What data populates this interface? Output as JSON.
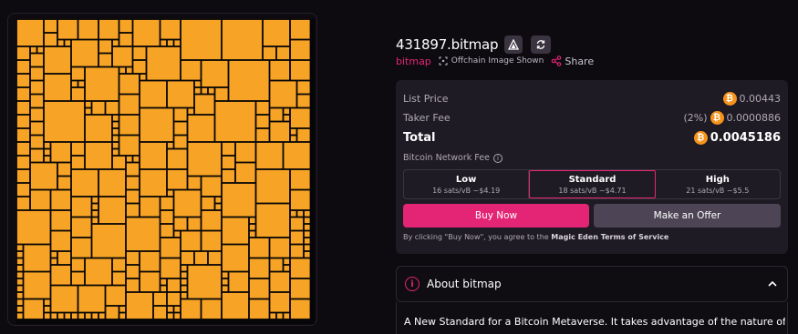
{
  "nft": {
    "title": "431897.bitmap",
    "collection": "bitmap",
    "offchain_label": "Offchain Image Shown",
    "share_label": "Share",
    "image_color": "#f7a325"
  },
  "price": {
    "list_price_label": "List Price",
    "list_price_value": "0.00443",
    "taker_fee_label": "Taker Fee",
    "taker_fee_pct": "(2%)",
    "taker_fee_value": "0.0000886",
    "total_label": "Total",
    "total_value": "0.0045186",
    "btc_symbol": "₿"
  },
  "network_fee": {
    "label": "Bitcoin Network Fee",
    "options": [
      {
        "name": "Low",
        "detail": "16 sats/vB ~$4.19"
      },
      {
        "name": "Standard",
        "detail": "18 sats/vB ~$4.71"
      },
      {
        "name": "High",
        "detail": "21 sats/vB ~$5.5"
      }
    ],
    "selected": "Standard"
  },
  "actions": {
    "buy_now": "Buy Now",
    "make_offer": "Make an Offer"
  },
  "terms": {
    "prefix": "By clicking \"Buy Now\", you agree to the ",
    "link": "Magic Eden Terms of Service"
  },
  "about": {
    "title": "About bitmap",
    "text": "A New Standard for a Bitcoin Metaverse. It takes advantage of the nature of data's"
  },
  "colors": {
    "accent": "#e42575",
    "btc": "#f7931a",
    "panel": "#1f1b25"
  }
}
